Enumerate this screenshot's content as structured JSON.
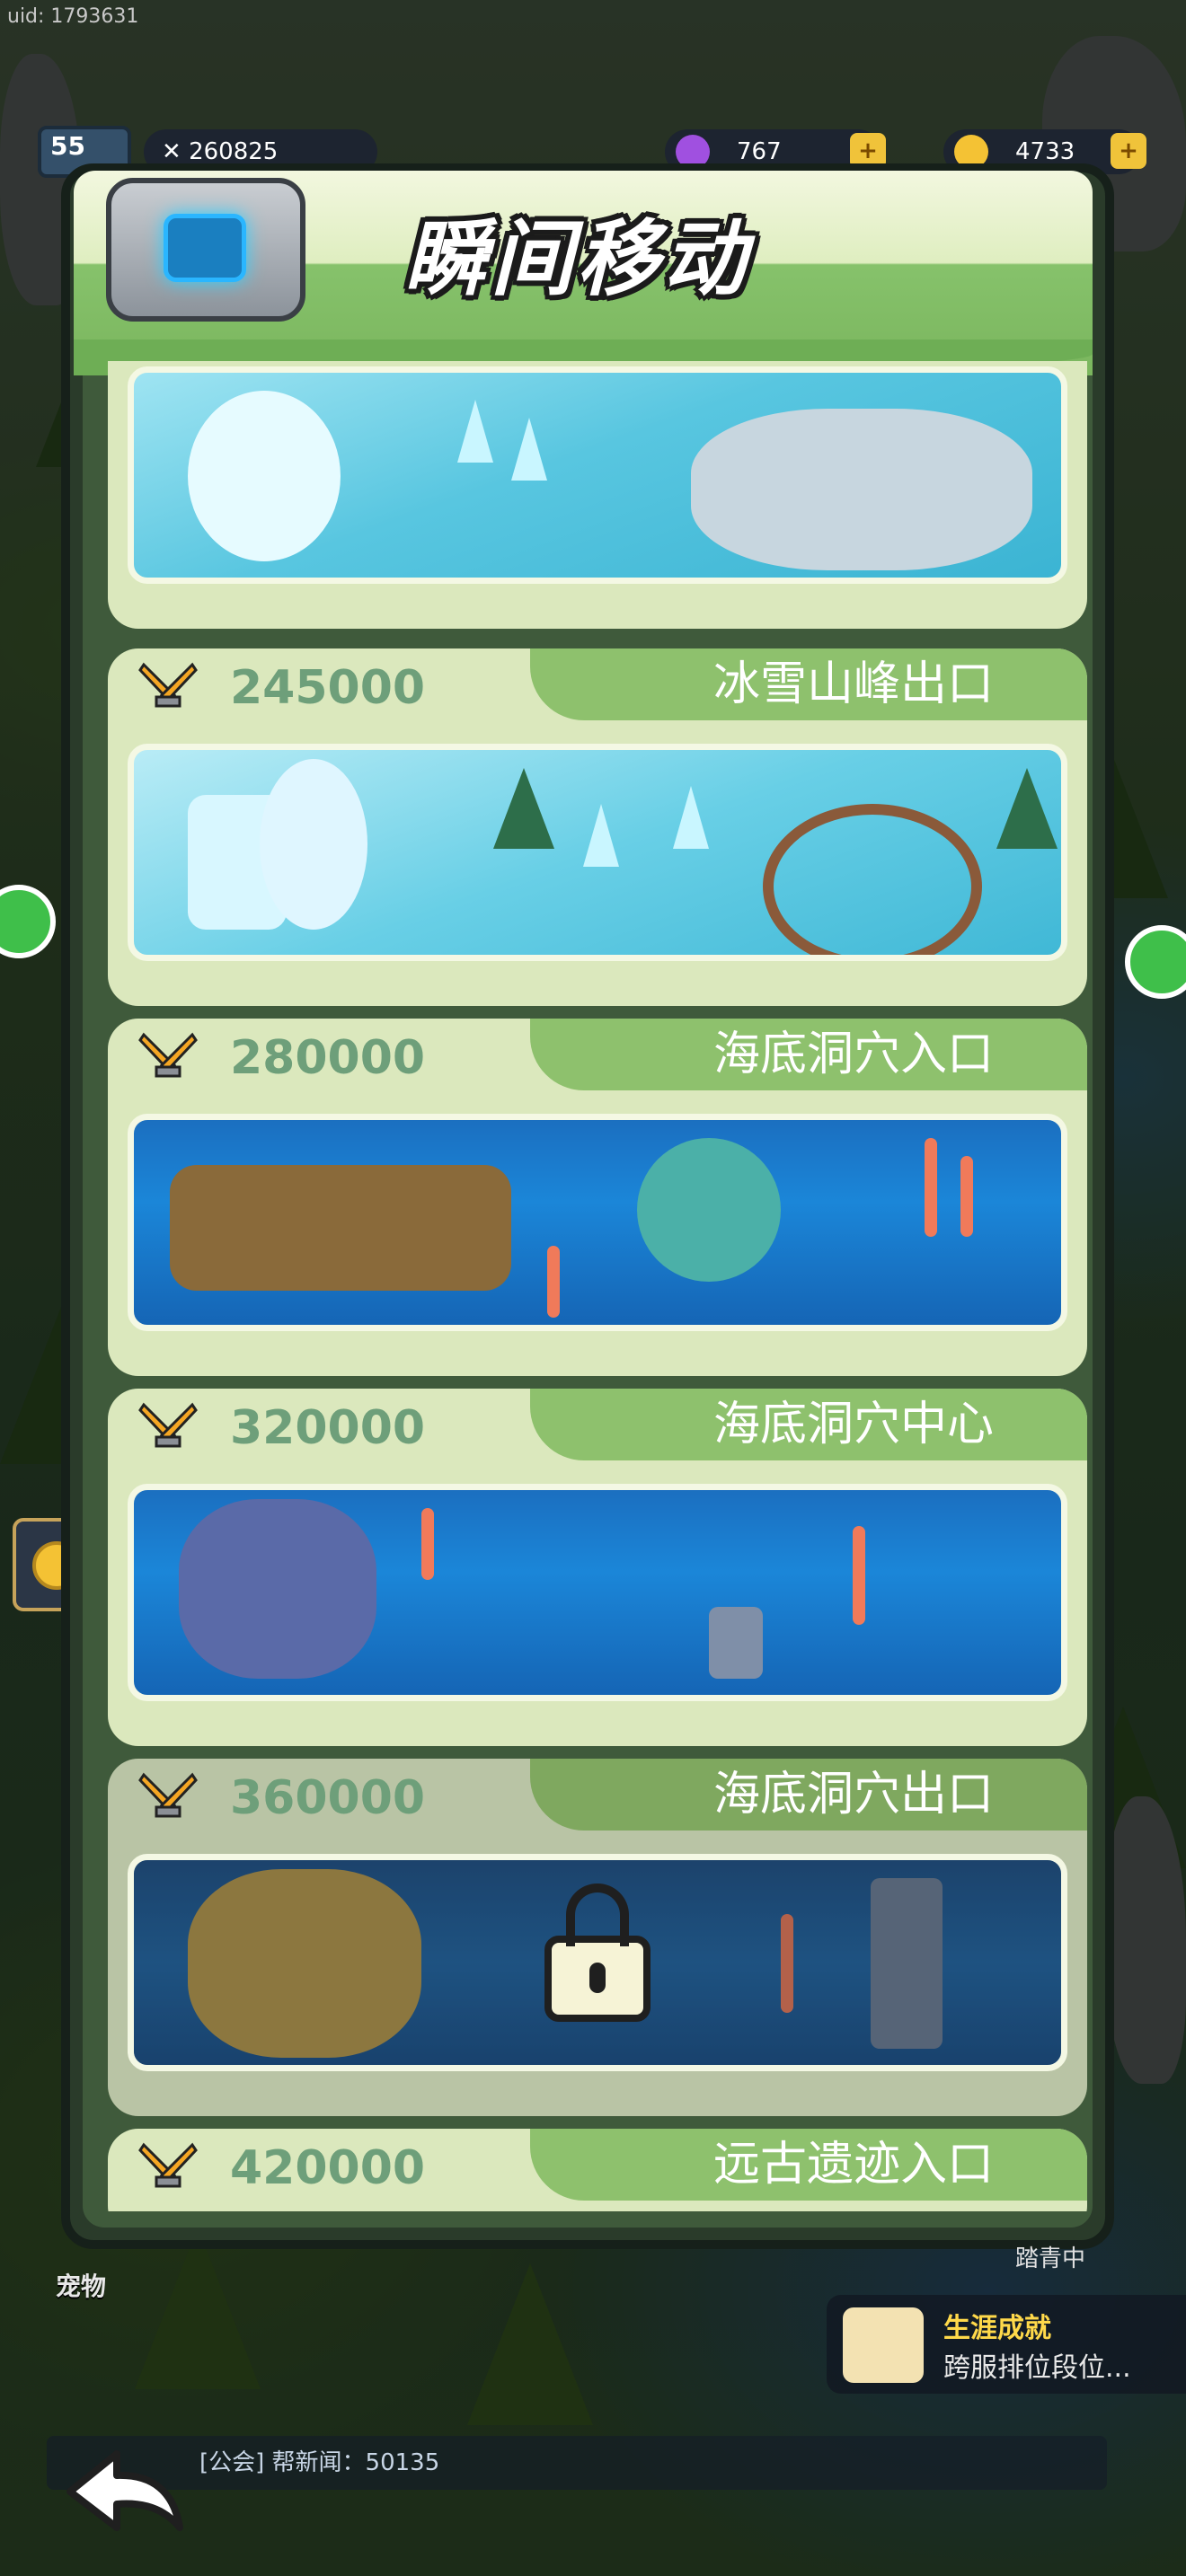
{
  "hud": {
    "uid": "uid: 1793631",
    "level": "55",
    "power": "260825",
    "gems": "767",
    "coins": "4733",
    "plus": "+"
  },
  "modal": {
    "title": "瞬间移动"
  },
  "teleports": [
    {
      "req": "",
      "name": "",
      "scene": "ice",
      "locked": false
    },
    {
      "req": "245000",
      "name": "冰雪山峰出口",
      "scene": "ice2",
      "locked": false
    },
    {
      "req": "280000",
      "name": "海底洞穴入口",
      "scene": "sea",
      "locked": false
    },
    {
      "req": "320000",
      "name": "海底洞穴中心",
      "scene": "sea",
      "locked": false
    },
    {
      "req": "360000",
      "name": "海底洞穴出口",
      "scene": "sea-dim",
      "locked": true
    },
    {
      "req": "420000",
      "name": "远古遗迹入口",
      "scene": "",
      "locked": false
    }
  ],
  "bottom": {
    "chat": "[公会] 帮新闻：50135",
    "achievement_title": "生涯成就",
    "achievement_desc": "跨服排位段位...",
    "pet_label": "宠物",
    "side_label": "踏青中"
  },
  "colors": {
    "card_bg": "#dbe8bd",
    "tab_green": "#8ec16d",
    "req_text": "#6e9f7a",
    "title_text": "#ffffff"
  },
  "icons": {
    "requirement": "crossed-swords-icon",
    "locked": "padlock-icon",
    "back": "back-arrow-icon",
    "emblem": "teleport-emblem-icon"
  }
}
